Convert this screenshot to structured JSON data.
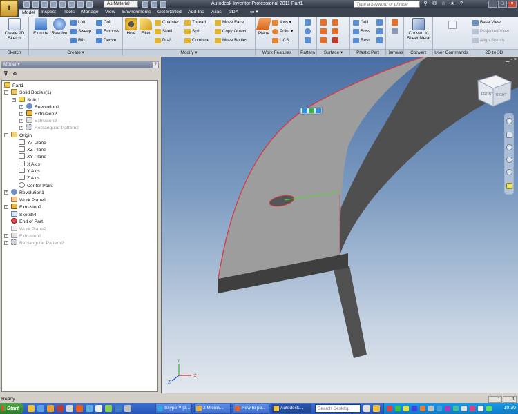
{
  "titlebar": {
    "app_button": "I",
    "material": "As Material",
    "title": "Autodesk Inventor Professional 2011   Part1",
    "search_placeholder": "Type a keyword or phrase",
    "minimize": "_",
    "maximize": "□",
    "close": "×"
  },
  "ribbon_tabs": [
    "Model",
    "Inspect",
    "Tools",
    "Manage",
    "View",
    "Environments",
    "Get Started",
    "Add-Ins",
    "Alias",
    "3DA"
  ],
  "ribbon": {
    "sketch": {
      "label": "Sketch",
      "create_2d_sketch": "Create 2D Sketch"
    },
    "create": {
      "label": "Create ▾",
      "extrude": "Extrude",
      "revolve": "Revolve",
      "loft": "Loft",
      "sweep": "Sweep",
      "rib": "Rib",
      "coil": "Coil",
      "emboss": "Emboss",
      "derive": "Derive"
    },
    "modify": {
      "label": "Modify ▾",
      "hole": "Hole",
      "fillet": "Fillet",
      "chamfer": "Chamfer",
      "shell": "Shell",
      "draft": "Draft",
      "thread": "Thread",
      "split": "Split",
      "combine": "Combine",
      "move_face": "Move Face",
      "copy_object": "Copy Object",
      "move_bodies": "Move Bodies"
    },
    "work_features": {
      "label": "Work Features",
      "plane": "Plane",
      "axis": "Axis ▾",
      "point": "Point ▾",
      "ucs": "UCS"
    },
    "pattern": {
      "label": "Pattern"
    },
    "surface": {
      "label": "Surface ▾"
    },
    "plastic_part": {
      "label": "Plastic Part",
      "grill": "Grill",
      "boss": "Boss",
      "rest": "Rest"
    },
    "harness": {
      "label": "Harness"
    },
    "convert": {
      "label": "Convert",
      "convert_to_sheet_metal": "Convert to Sheet Metal"
    },
    "user_commands": {
      "label": "User Commands"
    },
    "two_d_to_3d": {
      "label": "2D to 3D",
      "base_view": "Base View",
      "projected_view": "Projected View",
      "align_sketch": "Align Sketch"
    }
  },
  "browser": {
    "header": "Model ▾",
    "help": "?",
    "tree": [
      {
        "label": "Part1"
      },
      {
        "label": "Solid Bodies(1)"
      },
      {
        "label": "Solid1"
      },
      {
        "label": "Revolution1"
      },
      {
        "label": "Extrusion2"
      },
      {
        "label": "Extrusion3"
      },
      {
        "label": "Rectangular Pattern2"
      },
      {
        "label": "Origin"
      },
      {
        "label": "YZ Plane"
      },
      {
        "label": "XZ Plane"
      },
      {
        "label": "XY Plane"
      },
      {
        "label": "X Axis"
      },
      {
        "label": "Y Axis"
      },
      {
        "label": "Z Axis"
      },
      {
        "label": "Center Point"
      },
      {
        "label": "Revolution1"
      },
      {
        "label": "Work Plane1"
      },
      {
        "label": "Extrusion2"
      },
      {
        "label": "Sketch4"
      },
      {
        "label": "End of Part"
      },
      {
        "label": "Work Plane2"
      },
      {
        "label": "Extrusion3"
      },
      {
        "label": "Rectangular Pattern2"
      }
    ]
  },
  "viewcube": {
    "front": "FRONT",
    "right": "RIGHT"
  },
  "triad": {
    "x": "X",
    "y": "Y",
    "z": "Z"
  },
  "status": {
    "text": "Ready",
    "count1": "1",
    "count2": "1"
  },
  "taskbar": {
    "start": "Start",
    "tasks": [
      "Skype™ [2...",
      "2 Micros...",
      "How to pa...",
      "Autodesk..."
    ],
    "search_placeholder": "Search Desktop",
    "clock": "10:30"
  }
}
